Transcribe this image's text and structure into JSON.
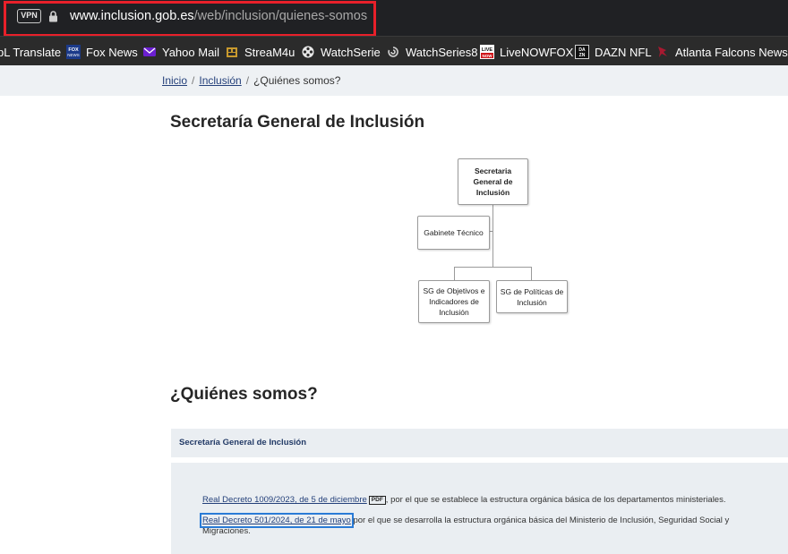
{
  "browser": {
    "vpn_label": "VPN",
    "url_host": "www.inclusion.gob.es",
    "url_path": "/web/inclusion/quienes-somos",
    "highlight_color": "#e8202a"
  },
  "bookmarks": [
    {
      "label": "pL Translate",
      "icon": "none"
    },
    {
      "label": "Fox News",
      "icon": "fox-news-icon"
    },
    {
      "label": "Yahoo Mail",
      "icon": "yahoo-mail-icon"
    },
    {
      "label": "StreaM4u",
      "icon": "film-icon"
    },
    {
      "label": "WatchSerie",
      "icon": "film-reel-icon"
    },
    {
      "label": "WatchSeries8",
      "icon": "swirl-icon"
    },
    {
      "label": "LiveNOWFOX",
      "icon": "live-now-icon"
    },
    {
      "label": "DAZN NFL",
      "icon": "dazn-icon"
    },
    {
      "label": "Atlanta Falcons News",
      "icon": "falcons-icon"
    }
  ],
  "breadcrumb": {
    "items": [
      "Inicio",
      "Inclusión"
    ],
    "current": "¿Quiénes somos?",
    "separator": "/"
  },
  "title": "Secretaría General de Inclusión",
  "org_chart": {
    "root": "Secretaria General de Inclusión",
    "staff": "Gabinete Técnico",
    "children": [
      "SG de Objetivos e Indicadores de Inclusión",
      "SG de Políticas de Inclusión"
    ]
  },
  "section_title": "¿Quiénes somos?",
  "accordion": {
    "header": "Secretaría General de Inclusión",
    "items": [
      {
        "link": "Real Decreto 1009/2023, de 5 de diciembre",
        "badge": "PDF",
        "text": ", por el que se establece la estructura orgánica básica de los departamentos ministeriales."
      },
      {
        "link": "Real Decreto 501/2024, de 21 de mayo",
        "text": " por el que se desarrolla la estructura orgánica básica del Ministerio de Inclusión, Seguridad Social y Migraciones."
      }
    ]
  }
}
